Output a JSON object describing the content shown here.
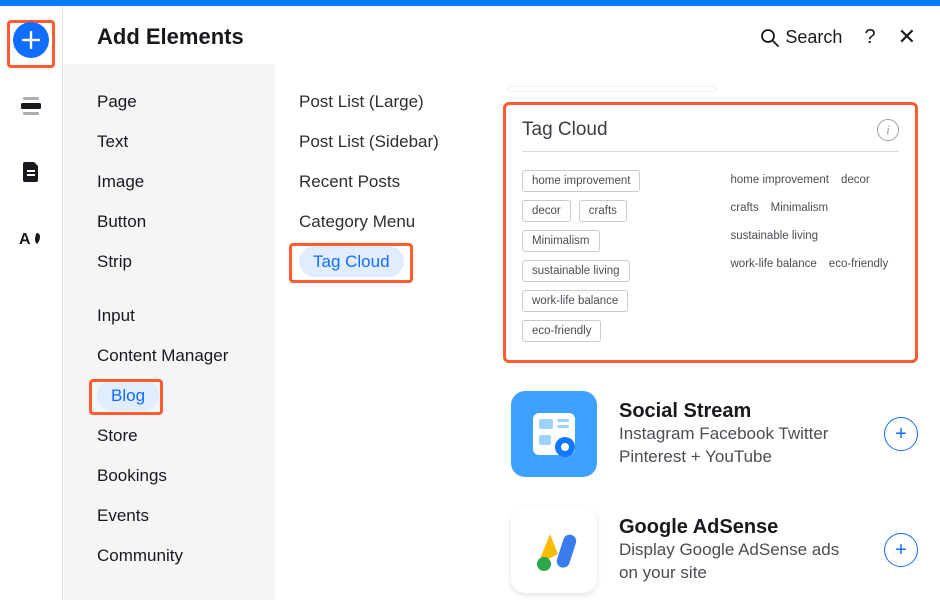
{
  "panel": {
    "title": "Add Elements",
    "search_label": "Search",
    "help": "?",
    "close": "✕"
  },
  "categories": [
    {
      "label": "Page"
    },
    {
      "label": "Text"
    },
    {
      "label": "Image"
    },
    {
      "label": "Button"
    },
    {
      "label": "Strip"
    },
    {
      "label": "Input",
      "sep": true
    },
    {
      "label": "Content Manager"
    },
    {
      "label": "Blog",
      "active": true,
      "highlight": true
    },
    {
      "label": "Store"
    },
    {
      "label": "Bookings"
    },
    {
      "label": "Events"
    },
    {
      "label": "Community"
    }
  ],
  "subitems": [
    {
      "label": "Post List (Large)"
    },
    {
      "label": "Post List (Sidebar)"
    },
    {
      "label": "Recent Posts"
    },
    {
      "label": "Category Menu"
    },
    {
      "label": "Tag Cloud",
      "active": true,
      "highlight": true
    }
  ],
  "preview": {
    "title": "Tag Cloud",
    "tags_boxed": [
      "home improvement",
      "decor",
      "crafts",
      "Minimalism",
      "sustainable living",
      "work-life balance",
      "eco-friendly"
    ],
    "tags_plain": [
      "home improvement",
      "decor",
      "crafts",
      "Minimalism",
      "sustainable living",
      "work-life balance",
      "eco-friendly"
    ]
  },
  "apps": [
    {
      "name": "Social Stream",
      "desc": "Instagram Facebook Twitter Pinterest + YouTube",
      "icon": "social"
    },
    {
      "name": "Google AdSense",
      "desc": "Display Google AdSense ads on your site",
      "icon": "adsense"
    }
  ]
}
